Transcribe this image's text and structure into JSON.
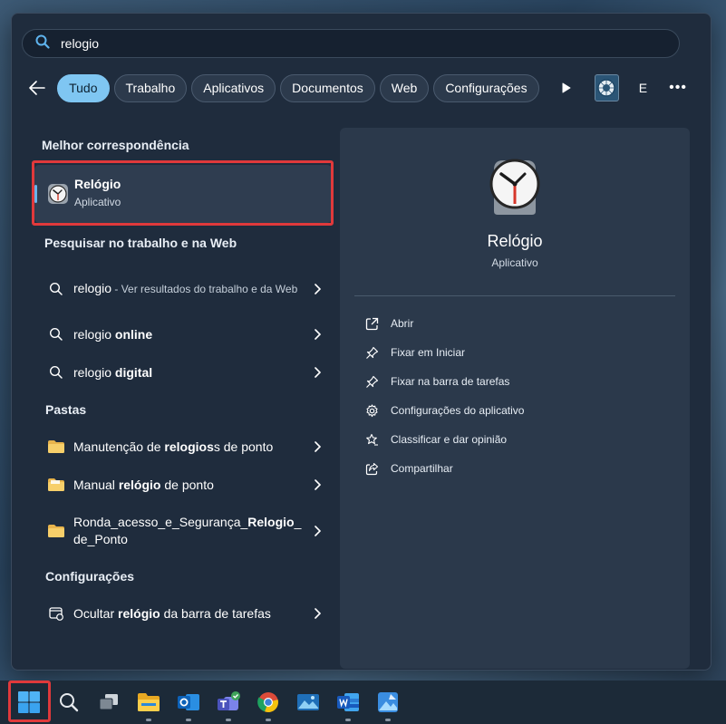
{
  "search": {
    "value": "relogio"
  },
  "filters": {
    "chips": [
      "Tudo",
      "Trabalho",
      "Aplicativos",
      "Documentos",
      "Web",
      "Configurações"
    ],
    "avatar_letter": "E",
    "more": "•••"
  },
  "sections": {
    "best": "Melhor correspondência",
    "web": "Pesquisar no trabalho e na Web",
    "folders": "Pastas",
    "settings": "Configurações"
  },
  "best_match": {
    "title": "Relógio",
    "subtitle": "Aplicativo"
  },
  "web_results": [
    {
      "pre": "relogio",
      "bold": "",
      "muted": " - Ver resultados do trabalho e da Web"
    },
    {
      "pre": "relogio ",
      "bold": "online",
      "muted": ""
    },
    {
      "pre": "relogio ",
      "bold": "digital",
      "muted": ""
    }
  ],
  "folders": [
    {
      "pre": "Manutenção de ",
      "bold": "relogios",
      "post": "s de ponto"
    },
    {
      "pre": "Manual ",
      "bold": "relógio",
      "post": " de ponto"
    },
    {
      "pre": "Ronda_acesso_e_Segurança_",
      "bold": "Relogio",
      "post": "_de_Ponto"
    }
  ],
  "settings_results": [
    {
      "pre": "Ocultar ",
      "bold": "relógio",
      "post": " da barra de tarefas"
    }
  ],
  "detail": {
    "name": "Relógio",
    "kind": "Aplicativo",
    "actions": [
      "Abrir",
      "Fixar em Iniciar",
      "Fixar na barra de tarefas",
      "Configurações do aplicativo",
      "Classificar e dar opinião",
      "Compartilhar"
    ]
  },
  "taskbar": {
    "icons": [
      "windows-start-icon",
      "search-icon",
      "task-view-icon",
      "file-explorer-icon",
      "outlook-icon",
      "teams-icon",
      "chrome-icon",
      "photos-icon",
      "word-icon",
      "paint-icon"
    ]
  },
  "colors": {
    "accent": "#7fc6f2",
    "highlight": "#e0393b",
    "panel": "#1f2c3d"
  }
}
